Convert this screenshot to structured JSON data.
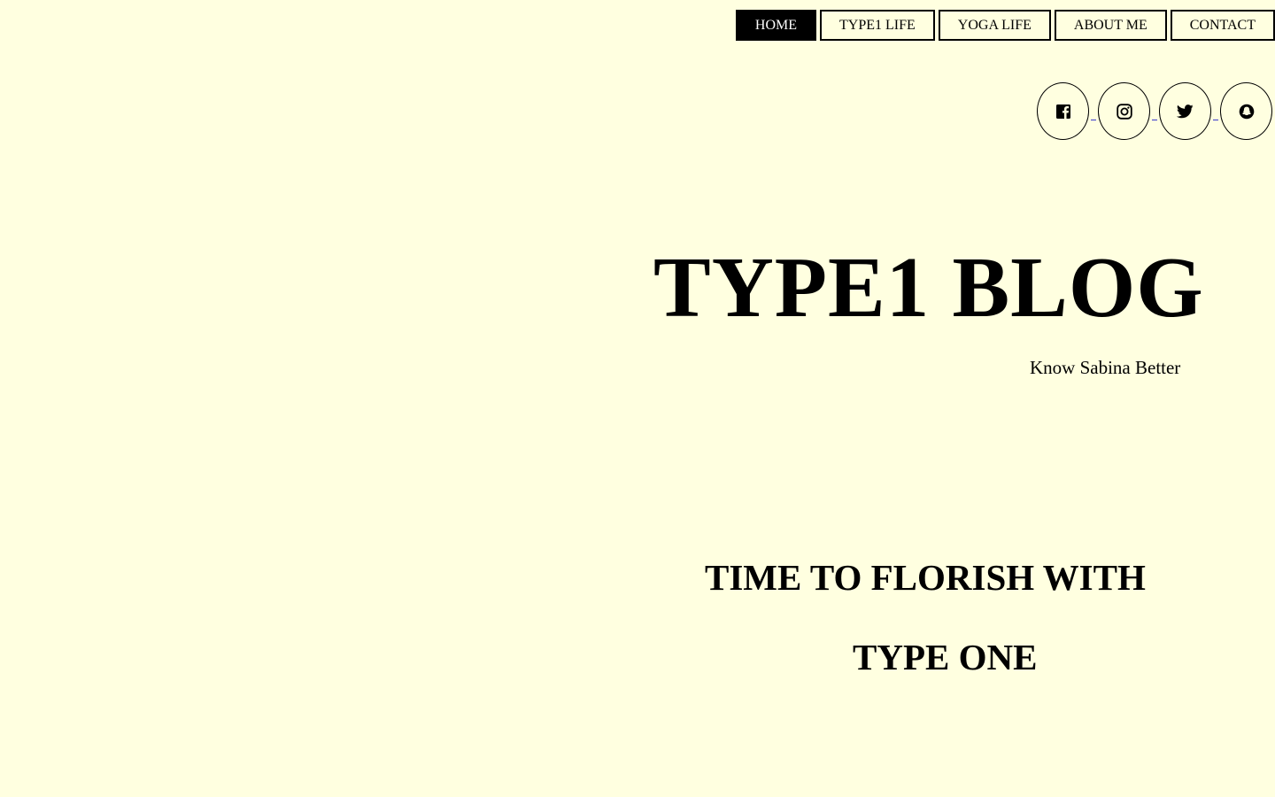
{
  "nav": {
    "items": [
      {
        "label": "HOME",
        "active": true
      },
      {
        "label": "TYPE1 LIFE",
        "active": false
      },
      {
        "label": "YOGA LIFE",
        "active": false
      },
      {
        "label": "ABOUT ME",
        "active": false
      },
      {
        "label": "CONTACT",
        "active": false
      }
    ]
  },
  "social": {
    "icons": [
      "facebook-icon",
      "instagram-icon",
      "twitter-icon",
      "snapchat-icon"
    ]
  },
  "hero": {
    "title": "TYPE1 BLOG",
    "subtitle": "Know Sabina Better",
    "tagline_line1": "TIME TO FLORISH WITH",
    "tagline_line2": "TYPE ONE"
  },
  "colors": {
    "background": "#ffffe0",
    "text": "#000000",
    "active_nav_bg": "#000000",
    "active_nav_text": "#ffffff"
  }
}
